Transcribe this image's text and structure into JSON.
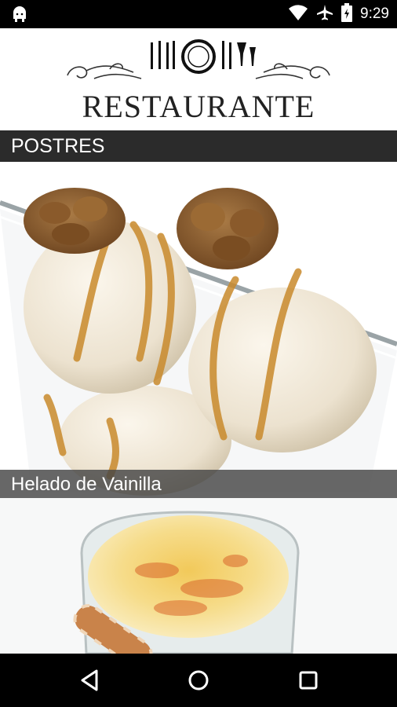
{
  "status_bar": {
    "time": "9:29",
    "icons": [
      "android-icon",
      "wifi-icon",
      "airplane-icon",
      "battery-icon"
    ]
  },
  "header": {
    "logo_text": "RESTAURANTE"
  },
  "section": {
    "title": "POSTRES"
  },
  "dishes": [
    {
      "name": "Helado de Vainilla",
      "image": "vanilla-ice-cream-photo"
    },
    {
      "name": "",
      "image": "custard-dessert-photo"
    }
  ],
  "navigation": {
    "buttons": [
      "back-icon",
      "home-icon",
      "recents-icon"
    ]
  },
  "colors": {
    "status_bar": "#000000",
    "section_bar": "#2b2b2b",
    "caption_bg": "#464646",
    "nav_bar": "#000000"
  }
}
